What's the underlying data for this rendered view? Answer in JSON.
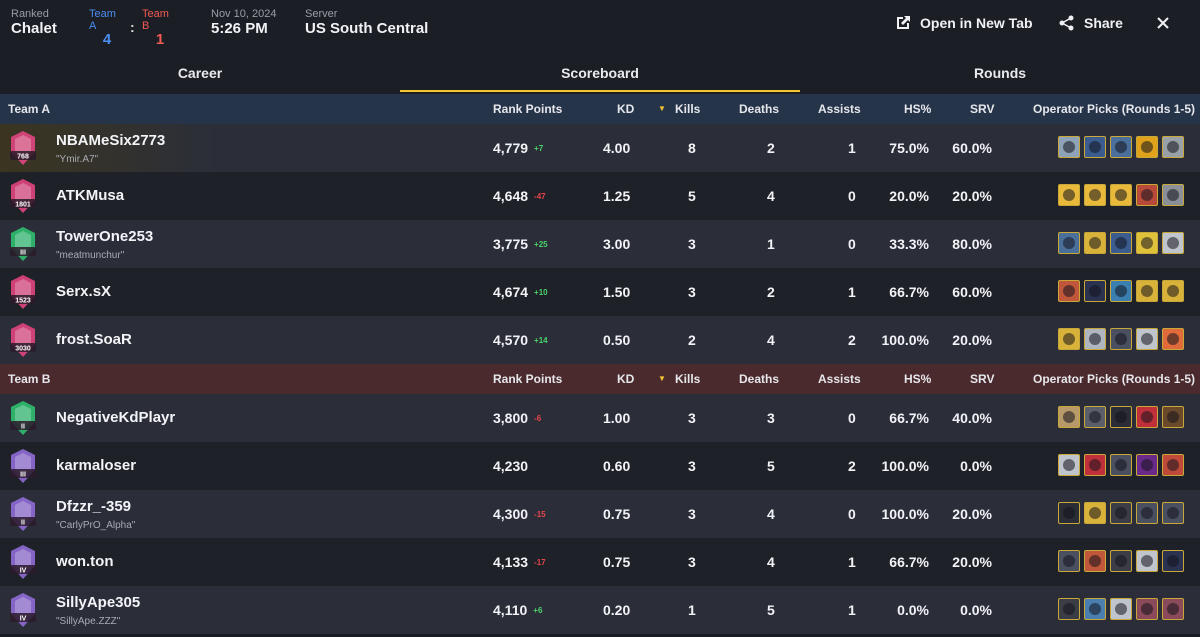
{
  "header": {
    "mode_label": "Ranked",
    "map": "Chalet",
    "teamA_label": "Team A",
    "teamB_label": "Team B",
    "teamA_score": "4",
    "teamB_score": "1",
    "colon": ":",
    "date": "Nov 10, 2024",
    "time": "5:26 PM",
    "server_label": "Server",
    "server": "US South Central",
    "open_new_tab": "Open in New Tab",
    "share": "Share"
  },
  "tabs": [
    {
      "label": "Career"
    },
    {
      "label": "Scoreboard"
    },
    {
      "label": "Rounds"
    }
  ],
  "columns": {
    "rank_points": "Rank Points",
    "kd": "KD",
    "kills": "Kills",
    "deaths": "Deaths",
    "assists": "Assists",
    "hs": "HS%",
    "srv": "SRV",
    "operators": "Operator Picks (Rounds 1-5)"
  },
  "teams": [
    {
      "name": "Team A",
      "accent": "#263449",
      "players": [
        {
          "name": "NBAMeSix2773",
          "sub": "\"Ymir.A7\"",
          "badge": "768",
          "rank_color": "#e0457f",
          "rank_points": "4,779",
          "delta": "+7",
          "kd": "4.00",
          "kills": "8",
          "deaths": "2",
          "assists": "1",
          "hs": "75.0%",
          "srv": "60.0%",
          "ops": [
            "#8fa3b8",
            "#3b5c8f",
            "#4a6f9a",
            "#e0a21b",
            "#9aa0a8"
          ]
        },
        {
          "name": "ATKMusa",
          "sub": "",
          "badge": "1801",
          "rank_color": "#e0457f",
          "rank_points": "4,648",
          "delta": "-47",
          "kd": "1.25",
          "kills": "5",
          "deaths": "4",
          "assists": "0",
          "hs": "20.0%",
          "srv": "20.0%",
          "ops": [
            "#e8b93a",
            "#e8b93a",
            "#e8b93a",
            "#b94a3a",
            "#8a8f98"
          ]
        },
        {
          "name": "TowerOne253",
          "sub": "\"meatmunchur\"",
          "badge": "III",
          "rank_color": "#2fbf71",
          "rank_points": "3,775",
          "delta": "+25",
          "kd": "3.00",
          "kills": "3",
          "deaths": "1",
          "assists": "0",
          "hs": "33.3%",
          "srv": "80.0%",
          "ops": [
            "#4a6f9a",
            "#d9b23a",
            "#3b5c8f",
            "#e0c23a",
            "#c0c4cc"
          ]
        },
        {
          "name": "Serx.sX",
          "sub": "",
          "badge": "1523",
          "rank_color": "#e0457f",
          "rank_points": "4,674",
          "delta": "+10",
          "kd": "1.50",
          "kills": "3",
          "deaths": "2",
          "assists": "1",
          "hs": "66.7%",
          "srv": "60.0%",
          "ops": [
            "#c0563a",
            "#2a3250",
            "#3a7fb0",
            "#d9b23a",
            "#d9b23a"
          ]
        },
        {
          "name": "frost.SoaR",
          "sub": "",
          "badge": "3030",
          "rank_color": "#e0457f",
          "rank_points": "4,570",
          "delta": "+14",
          "kd": "0.50",
          "kills": "2",
          "deaths": "4",
          "assists": "2",
          "hs": "100.0%",
          "srv": "20.0%",
          "ops": [
            "#d9b23a",
            "#b0b6c0",
            "#4a5060",
            "#c0c4cc",
            "#e06a3a"
          ]
        }
      ]
    },
    {
      "name": "Team B",
      "accent": "#4a2a2c",
      "players": [
        {
          "name": "NegativeKdPlayr",
          "sub": "",
          "badge": "II",
          "rank_color": "#2fbf71",
          "rank_points": "3,800",
          "delta": "-6",
          "kd": "1.00",
          "kills": "3",
          "deaths": "3",
          "assists": "0",
          "hs": "66.7%",
          "srv": "40.0%",
          "ops": [
            "#b89a6a",
            "#5a5f6a",
            "#2a2c36",
            "#c0303a",
            "#6a4a2a"
          ]
        },
        {
          "name": "karmaloser",
          "sub": "",
          "badge": "III",
          "rank_color": "#8f6bd6",
          "rank_points": "4,230",
          "delta": "",
          "kd": "0.60",
          "kills": "3",
          "deaths": "5",
          "assists": "2",
          "hs": "100.0%",
          "srv": "0.0%",
          "ops": [
            "#c0c4cc",
            "#c0303a",
            "#4a5060",
            "#6a2a8a",
            "#c04a3a"
          ]
        },
        {
          "name": "Dfzzr_-359",
          "sub": "\"CarlyPrO_Alpha\"",
          "badge": "II",
          "rank_color": "#8f6bd6",
          "rank_points": "4,300",
          "delta": "-15",
          "kd": "0.75",
          "kills": "3",
          "deaths": "4",
          "assists": "0",
          "hs": "100.0%",
          "srv": "20.0%",
          "ops": [
            "#2a2c36",
            "#d9b23a",
            "#3a3c46",
            "#4a5060",
            "#4a5060"
          ]
        },
        {
          "name": "won.ton",
          "sub": "",
          "badge": "IV",
          "rank_color": "#8f6bd6",
          "rank_points": "4,133",
          "delta": "-17",
          "kd": "0.75",
          "kills": "3",
          "deaths": "4",
          "assists": "1",
          "hs": "66.7%",
          "srv": "20.0%",
          "ops": [
            "#4a5060",
            "#c0563a",
            "#3a3c46",
            "#c0c4cc",
            "#2a3250"
          ]
        },
        {
          "name": "SillyApe305",
          "sub": "\"SillyApe.ZZZ\"",
          "badge": "IV",
          "rank_color": "#8f6bd6",
          "rank_points": "4,110",
          "delta": "+6",
          "kd": "0.20",
          "kills": "1",
          "deaths": "5",
          "assists": "1",
          "hs": "0.0%",
          "srv": "0.0%",
          "ops": [
            "#3a3c46",
            "#4a7fb0",
            "#c0c4cc",
            "#8a4a5a",
            "#8a4a5a"
          ]
        }
      ]
    }
  ],
  "colors": {
    "active_tab_underline": "#f4c430",
    "teamA": "#4a8ef0",
    "teamB": "#f25a52",
    "positive": "#4bd36b",
    "negative": "#e8454a"
  }
}
